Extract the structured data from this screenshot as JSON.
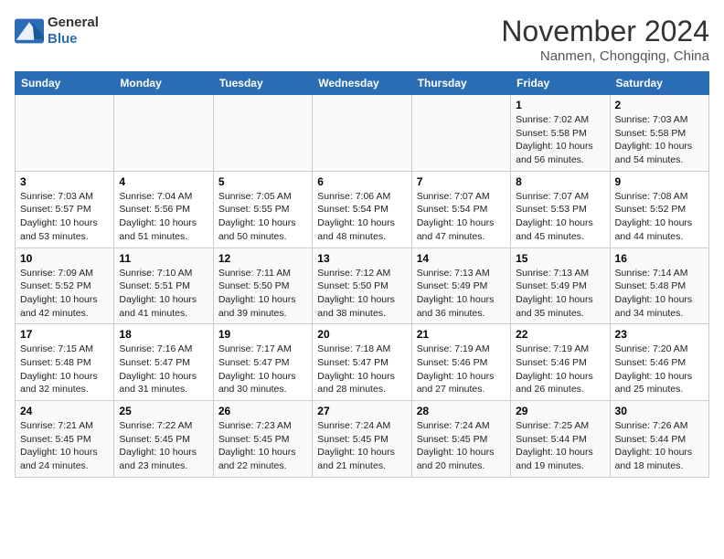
{
  "header": {
    "logo_line1": "General",
    "logo_line2": "Blue",
    "month": "November 2024",
    "location": "Nanmen, Chongqing, China"
  },
  "weekdays": [
    "Sunday",
    "Monday",
    "Tuesday",
    "Wednesday",
    "Thursday",
    "Friday",
    "Saturday"
  ],
  "weeks": [
    [
      {
        "day": "",
        "info": ""
      },
      {
        "day": "",
        "info": ""
      },
      {
        "day": "",
        "info": ""
      },
      {
        "day": "",
        "info": ""
      },
      {
        "day": "",
        "info": ""
      },
      {
        "day": "1",
        "info": "Sunrise: 7:02 AM\nSunset: 5:58 PM\nDaylight: 10 hours\nand 56 minutes."
      },
      {
        "day": "2",
        "info": "Sunrise: 7:03 AM\nSunset: 5:58 PM\nDaylight: 10 hours\nand 54 minutes."
      }
    ],
    [
      {
        "day": "3",
        "info": "Sunrise: 7:03 AM\nSunset: 5:57 PM\nDaylight: 10 hours\nand 53 minutes."
      },
      {
        "day": "4",
        "info": "Sunrise: 7:04 AM\nSunset: 5:56 PM\nDaylight: 10 hours\nand 51 minutes."
      },
      {
        "day": "5",
        "info": "Sunrise: 7:05 AM\nSunset: 5:55 PM\nDaylight: 10 hours\nand 50 minutes."
      },
      {
        "day": "6",
        "info": "Sunrise: 7:06 AM\nSunset: 5:54 PM\nDaylight: 10 hours\nand 48 minutes."
      },
      {
        "day": "7",
        "info": "Sunrise: 7:07 AM\nSunset: 5:54 PM\nDaylight: 10 hours\nand 47 minutes."
      },
      {
        "day": "8",
        "info": "Sunrise: 7:07 AM\nSunset: 5:53 PM\nDaylight: 10 hours\nand 45 minutes."
      },
      {
        "day": "9",
        "info": "Sunrise: 7:08 AM\nSunset: 5:52 PM\nDaylight: 10 hours\nand 44 minutes."
      }
    ],
    [
      {
        "day": "10",
        "info": "Sunrise: 7:09 AM\nSunset: 5:52 PM\nDaylight: 10 hours\nand 42 minutes."
      },
      {
        "day": "11",
        "info": "Sunrise: 7:10 AM\nSunset: 5:51 PM\nDaylight: 10 hours\nand 41 minutes."
      },
      {
        "day": "12",
        "info": "Sunrise: 7:11 AM\nSunset: 5:50 PM\nDaylight: 10 hours\nand 39 minutes."
      },
      {
        "day": "13",
        "info": "Sunrise: 7:12 AM\nSunset: 5:50 PM\nDaylight: 10 hours\nand 38 minutes."
      },
      {
        "day": "14",
        "info": "Sunrise: 7:13 AM\nSunset: 5:49 PM\nDaylight: 10 hours\nand 36 minutes."
      },
      {
        "day": "15",
        "info": "Sunrise: 7:13 AM\nSunset: 5:49 PM\nDaylight: 10 hours\nand 35 minutes."
      },
      {
        "day": "16",
        "info": "Sunrise: 7:14 AM\nSunset: 5:48 PM\nDaylight: 10 hours\nand 34 minutes."
      }
    ],
    [
      {
        "day": "17",
        "info": "Sunrise: 7:15 AM\nSunset: 5:48 PM\nDaylight: 10 hours\nand 32 minutes."
      },
      {
        "day": "18",
        "info": "Sunrise: 7:16 AM\nSunset: 5:47 PM\nDaylight: 10 hours\nand 31 minutes."
      },
      {
        "day": "19",
        "info": "Sunrise: 7:17 AM\nSunset: 5:47 PM\nDaylight: 10 hours\nand 30 minutes."
      },
      {
        "day": "20",
        "info": "Sunrise: 7:18 AM\nSunset: 5:47 PM\nDaylight: 10 hours\nand 28 minutes."
      },
      {
        "day": "21",
        "info": "Sunrise: 7:19 AM\nSunset: 5:46 PM\nDaylight: 10 hours\nand 27 minutes."
      },
      {
        "day": "22",
        "info": "Sunrise: 7:19 AM\nSunset: 5:46 PM\nDaylight: 10 hours\nand 26 minutes."
      },
      {
        "day": "23",
        "info": "Sunrise: 7:20 AM\nSunset: 5:46 PM\nDaylight: 10 hours\nand 25 minutes."
      }
    ],
    [
      {
        "day": "24",
        "info": "Sunrise: 7:21 AM\nSunset: 5:45 PM\nDaylight: 10 hours\nand 24 minutes."
      },
      {
        "day": "25",
        "info": "Sunrise: 7:22 AM\nSunset: 5:45 PM\nDaylight: 10 hours\nand 23 minutes."
      },
      {
        "day": "26",
        "info": "Sunrise: 7:23 AM\nSunset: 5:45 PM\nDaylight: 10 hours\nand 22 minutes."
      },
      {
        "day": "27",
        "info": "Sunrise: 7:24 AM\nSunset: 5:45 PM\nDaylight: 10 hours\nand 21 minutes."
      },
      {
        "day": "28",
        "info": "Sunrise: 7:24 AM\nSunset: 5:45 PM\nDaylight: 10 hours\nand 20 minutes."
      },
      {
        "day": "29",
        "info": "Sunrise: 7:25 AM\nSunset: 5:44 PM\nDaylight: 10 hours\nand 19 minutes."
      },
      {
        "day": "30",
        "info": "Sunrise: 7:26 AM\nSunset: 5:44 PM\nDaylight: 10 hours\nand 18 minutes."
      }
    ]
  ]
}
